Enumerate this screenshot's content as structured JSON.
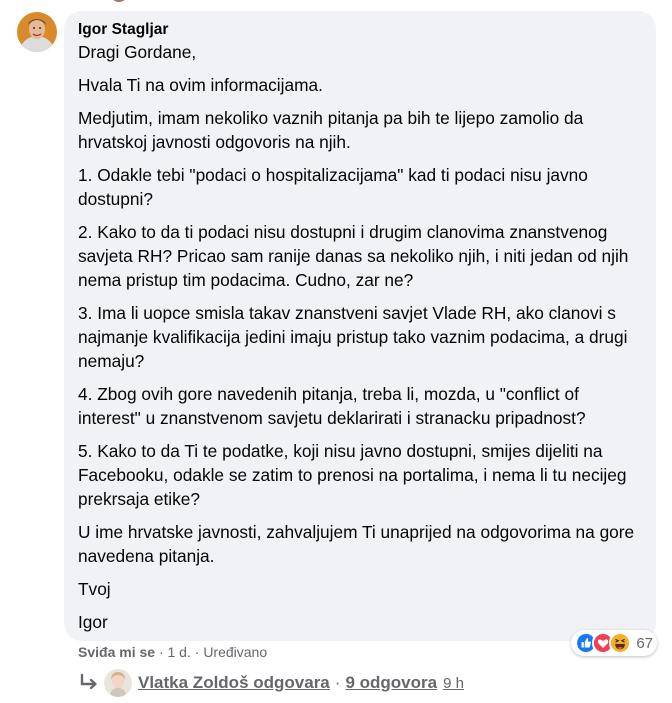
{
  "comment": {
    "author": "Igor Stagljar",
    "paragraphs": [
      "Dragi Gordane,",
      "Hvala Ti na ovim informacijama.",
      "Medjutim, imam nekoliko vaznih pitanja pa bih te lijepo zamolio da hrvatskoj javnosti odgovoris na njih.",
      "1. Odakle tebi \"podaci o hospitalizacijama\" kad ti podaci nisu javno dostupni?",
      "2. Kako to da ti podaci nisu dostupni i drugim clanovima znanstvenog savjeta RH? Pricao sam ranije danas sa nekoliko njih, i niti jedan od njih nema pristup tim podacima. Cudno, zar ne?",
      "3. Ima li uopce smisla takav znanstveni savjet Vlade RH, ako clanovi s najmanje kvalifikacija jedini imaju pristup tako vaznim podacima, a drugi nemaju?",
      "4. Zbog ovih gore navedenih pitanja, treba li, mozda, u \"conflict of interest\" u znanstvenom savjetu deklarirati i stranacku pripadnost?",
      "5. Kako to da Ti te podatke, koji nisu javno dostupni, smijes dijeliti na Facebooku, odakle se zatim to prenosi na portalima, i nema li tu necijeg prekrsaja etike?",
      "U ime hrvatske javnosti, zahvaljujem Ti unaprijed na odgovorima na gore navedena pitanja.",
      "Tvoj",
      "Igor"
    ]
  },
  "actions": {
    "like": "Sviđa mi se",
    "sep": "·",
    "time": "1 d.",
    "edited": "Uređivano"
  },
  "reactions": {
    "icons": [
      "like-reaction-icon",
      "love-reaction-icon",
      "haha-reaction-icon"
    ],
    "count": "67",
    "colors": {
      "like": "#1877f2",
      "love": "#f33e58",
      "haha": "#f7b125"
    }
  },
  "reply": {
    "name": "Vlatka Zoldoš odgovara",
    "sep": "·",
    "count": "9 odgovora",
    "time": "9 h"
  }
}
